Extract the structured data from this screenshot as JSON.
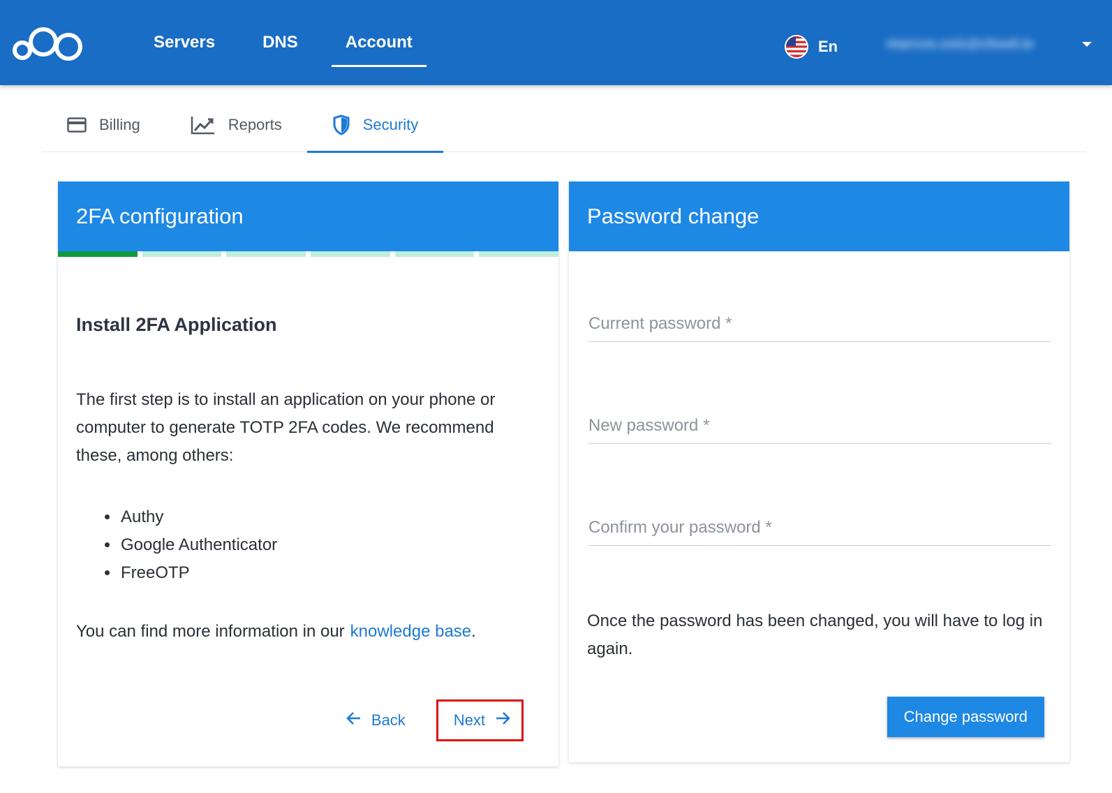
{
  "header": {
    "nav": [
      {
        "label": "Servers",
        "active": false
      },
      {
        "label": "DNS",
        "active": false
      },
      {
        "label": "Account",
        "active": true
      }
    ],
    "language": "En",
    "user_email": "marcos.ssiz@cloud.io"
  },
  "subtabs": [
    {
      "label": "Billing",
      "icon": "credit-card-icon"
    },
    {
      "label": "Reports",
      "icon": "trend-chart-icon"
    },
    {
      "label": "Security",
      "icon": "shield-icon",
      "active": true
    }
  ],
  "twofa": {
    "title": "2FA configuration",
    "steps_total": 6,
    "steps_done": 1,
    "step_title": "Install 2FA Application",
    "description": "The first step is to install an application on your phone or computer to generate TOTP 2FA codes. We recommend these, among others:",
    "apps": [
      "Authy",
      "Google Authenticator",
      "FreeOTP"
    ],
    "kb_prefix": "You can find more information in our",
    "kb_link": "knowledge base",
    "kb_suffix": ".",
    "back_label": "Back",
    "next_label": "Next"
  },
  "password": {
    "title": "Password change",
    "current_placeholder": "Current password *",
    "new_placeholder": "New password *",
    "confirm_placeholder": "Confirm your password *",
    "note": "Once the password has been changed, you will have to log in again.",
    "submit_label": "Change password"
  },
  "colors": {
    "topbar": "#1a6dc4",
    "card_header": "#1e88e5",
    "link": "#1d79d6",
    "step_done": "#0e9a3e",
    "step_todo": "#bfeedd",
    "highlight": "#e01010"
  }
}
